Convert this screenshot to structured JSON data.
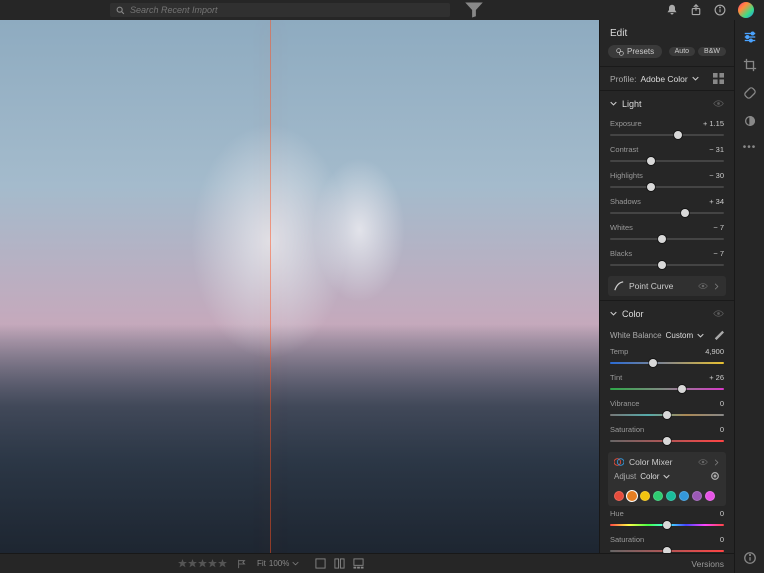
{
  "topbar": {
    "search_placeholder": "Search Recent Import"
  },
  "panel": {
    "title": "Edit",
    "presets_label": "Presets",
    "auto_label": "Auto",
    "bw_label": "B&W",
    "profile_label": "Profile:",
    "profile_value": "Adobe Color"
  },
  "light": {
    "title": "Light",
    "sliders": [
      {
        "label": "Exposure",
        "value": "+ 1.15",
        "pos": 60
      },
      {
        "label": "Contrast",
        "value": "− 31",
        "pos": 36
      },
      {
        "label": "Highlights",
        "value": "− 30",
        "pos": 36
      },
      {
        "label": "Shadows",
        "value": "+ 34",
        "pos": 66
      },
      {
        "label": "Whites",
        "value": "− 7",
        "pos": 46
      },
      {
        "label": "Blacks",
        "value": "− 7",
        "pos": 46
      }
    ],
    "point_curve": "Point Curve"
  },
  "color": {
    "title": "Color",
    "wb_label": "White Balance",
    "wb_value": "Custom",
    "sliders": [
      {
        "label": "Temp",
        "value": "4,900",
        "pos": 38,
        "grad": "temp"
      },
      {
        "label": "Tint",
        "value": "+ 26",
        "pos": 63,
        "grad": "tint"
      },
      {
        "label": "Vibrance",
        "value": "0",
        "pos": 50,
        "grad": "vib"
      },
      {
        "label": "Saturation",
        "value": "0",
        "pos": 50,
        "grad": "sat"
      }
    ]
  },
  "mixer": {
    "title": "Color Mixer",
    "adjust_label": "Adjust",
    "adjust_value": "Color",
    "colors": [
      "#e74c3c",
      "#e67e22",
      "#f1c40f",
      "#2ecc71",
      "#1abc9c",
      "#3498db",
      "#9b59b6",
      "#e754e7"
    ],
    "active_color": 1,
    "sliders": [
      {
        "label": "Hue",
        "value": "0",
        "pos": 50,
        "grad": "hue"
      },
      {
        "label": "Saturation",
        "value": "0",
        "pos": 50,
        "grad": "sat"
      }
    ]
  },
  "bottom": {
    "fit": "Fit",
    "zoom": "100%",
    "versions": "Versions"
  }
}
